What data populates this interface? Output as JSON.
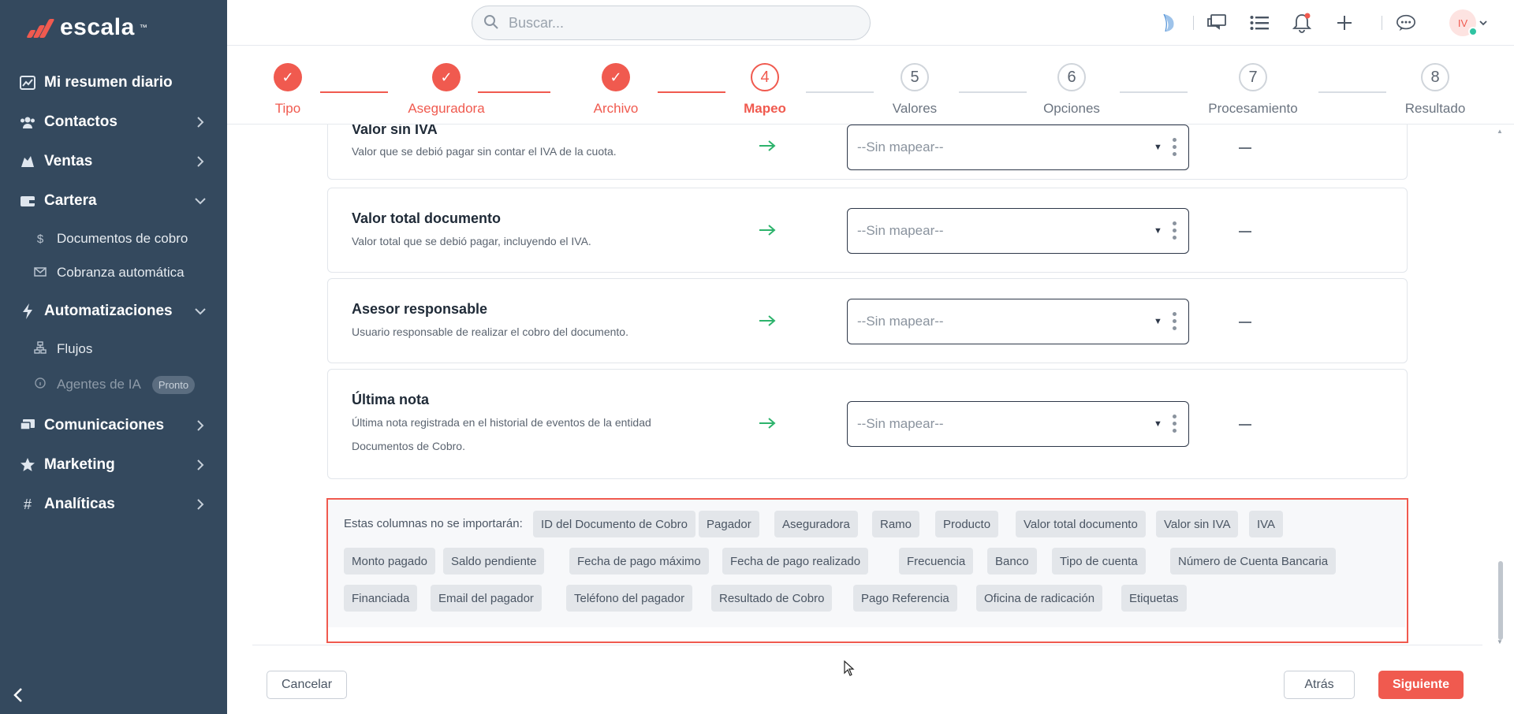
{
  "app": {
    "brand": "escala",
    "brand_tm": "™",
    "accent": "#f05a4f",
    "sidebar_bg": "#34495e"
  },
  "sidebar": {
    "items": [
      {
        "label": "Mi resumen diario",
        "icon": "chart-icon"
      },
      {
        "label": "Contactos",
        "icon": "users-icon"
      },
      {
        "label": "Ventas",
        "icon": "handshake-icon"
      },
      {
        "label": "Cartera",
        "icon": "wallet-icon"
      },
      {
        "label": "Automatizaciones",
        "icon": "bolt-icon"
      },
      {
        "label": "Comunicaciones",
        "icon": "chat-icon"
      },
      {
        "label": "Marketing",
        "icon": "star-icon"
      },
      {
        "label": "Analíticas",
        "icon": "hash-icon"
      }
    ],
    "cartera_sub": [
      {
        "label": "Documentos de cobro",
        "icon": "dollar-icon"
      },
      {
        "label": "Cobranza automática",
        "icon": "mail-icon"
      }
    ],
    "auto_sub": [
      {
        "label": "Flujos",
        "icon": "flow-icon"
      },
      {
        "label": "Agentes de IA",
        "icon": "info-icon",
        "badge": "Pronto"
      }
    ]
  },
  "topbar": {
    "search_placeholder": "Buscar...",
    "avatar_initials": "IV"
  },
  "stepper": {
    "steps": [
      {
        "num": "✓",
        "label": "Tipo",
        "state": "done"
      },
      {
        "num": "✓",
        "label": "Aseguradora",
        "state": "done"
      },
      {
        "num": "✓",
        "label": "Archivo",
        "state": "done"
      },
      {
        "num": "4",
        "label": "Mapeo",
        "state": "active"
      },
      {
        "num": "5",
        "label": "Valores",
        "state": "todo"
      },
      {
        "num": "6",
        "label": "Opciones",
        "state": "todo"
      },
      {
        "num": "7",
        "label": "Procesamiento",
        "state": "todo"
      },
      {
        "num": "8",
        "label": "Resultado",
        "state": "todo"
      }
    ]
  },
  "mapping": {
    "rows": [
      {
        "title": "Valor sin IVA",
        "desc": "Valor que se debió pagar sin contar el IVA de la cuota.",
        "value": "--Sin mapear--",
        "preview": "—"
      },
      {
        "title": "Valor total documento",
        "desc": "Valor total que se debió pagar, incluyendo el IVA.",
        "value": "--Sin mapear--",
        "preview": "—"
      },
      {
        "title": "Asesor responsable",
        "desc": "Usuario responsable de realizar el cobro del documento.",
        "value": "--Sin mapear--",
        "preview": "—"
      },
      {
        "title": "Última nota",
        "desc": "Última nota registrada en el historial de eventos de la entidad Documentos de Cobro.",
        "value": "--Sin mapear--",
        "preview": "—"
      }
    ]
  },
  "ignored": {
    "label": "Estas columnas no se importarán:",
    "chips": [
      "ID del Documento de Cobro",
      "Pagador",
      "Aseguradora",
      "Ramo",
      "Producto",
      "Valor total documento",
      "Valor sin IVA",
      "IVA",
      "Monto pagado",
      "Saldo pendiente",
      "Fecha de pago máximo",
      "Fecha de pago realizado",
      "Frecuencia",
      "Banco",
      "Tipo de cuenta",
      "Número de Cuenta Bancaria",
      "Financiada",
      "Email del pagador",
      "Teléfono del pagador",
      "Resultado de Cobro",
      "Pago Referencia",
      "Oficina de radicación",
      "Etiquetas"
    ]
  },
  "footer": {
    "cancel": "Cancelar",
    "back": "Atrás",
    "next": "Siguiente"
  }
}
